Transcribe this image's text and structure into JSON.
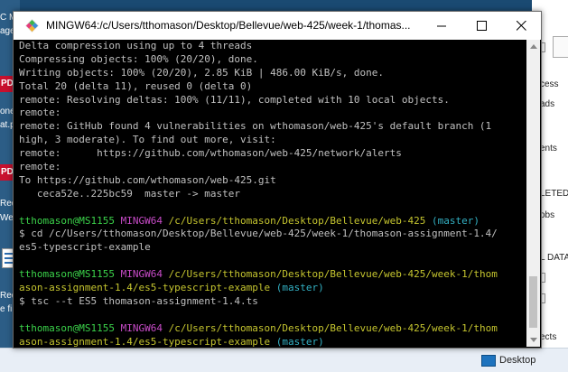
{
  "desktop": {
    "left_labels": [
      "C M",
      "age",
      "PDF",
      "one",
      "at.p",
      "PDF",
      "Req",
      "Wee",
      "Req",
      "e fi"
    ],
    "right_labels": [
      "cess",
      "ads",
      "ents",
      "LETED",
      "obs",
      "L DATA",
      "ects"
    ],
    "taskbar_label": "Desktop"
  },
  "window": {
    "title": "MINGW64:/c/Users/tthomason/Desktop/Bellevue/web-425/week-1/thomas...",
    "icons": {
      "app": "mingw-app-icon",
      "minimize": "minimize-icon",
      "maximize": "maximize-icon",
      "close": "close-icon"
    }
  },
  "terminal": {
    "out1": "Delta compression using up to 4 threads",
    "out2": "Compressing objects: 100% (20/20), done.",
    "out3": "Writing objects: 100% (20/20), 2.85 KiB | 486.00 KiB/s, done.",
    "out4": "Total 20 (delta 11), reused 0 (delta 0)",
    "out5": "remote: Resolving deltas: 100% (11/11), completed with 10 local objects.",
    "out6": "remote:",
    "out7": "remote: GitHub found 4 vulnerabilities on wthomason/web-425's default branch (1",
    "out8": "high, 3 moderate). To find out more, visit:",
    "out9": "remote:      https://github.com/wthomason/web-425/network/alerts",
    "out10": "remote:",
    "out11": "To https://github.com/wthomason/web-425.git",
    "out12": "   ceca52e..225bc59  master -> master",
    "p1_user": "tthomason@MS1155",
    "p1_env": "MINGW64",
    "p1_path": "/c/Users/tthomason/Desktop/Bellevue/web-425",
    "p1_branch": "(master)",
    "cmd1a": "$ cd /c/Users/tthomason/Desktop/Bellevue/web-425/week-1/thomason-assignment-1.4/",
    "cmd1b": "es5-typescript-example",
    "p2_user": "tthomason@MS1155",
    "p2_env": "MINGW64",
    "p2_path_a": "/c/Users/tthomason/Desktop/Bellevue/web-425/week-1/thom",
    "p2_path_b": "ason-assignment-1.4/es5-typescript-example",
    "p2_branch": "(master)",
    "cmd2": "$ tsc --t ES5 thomason-assignment-1.4.ts",
    "p3_user": "tthomason@MS1155",
    "p3_env": "MINGW64",
    "p3_path_a": "/c/Users/tthomason/Desktop/Bellevue/web-425/week-1/thom",
    "p3_path_b": "ason-assignment-1.4/es5-typescript-example",
    "p3_branch": "(master)",
    "prompt": "$ "
  },
  "colors": {
    "user_host": "#3bd24a",
    "env": "#c74bc7",
    "path": "#c5c52f",
    "branch": "#33b1c4"
  }
}
